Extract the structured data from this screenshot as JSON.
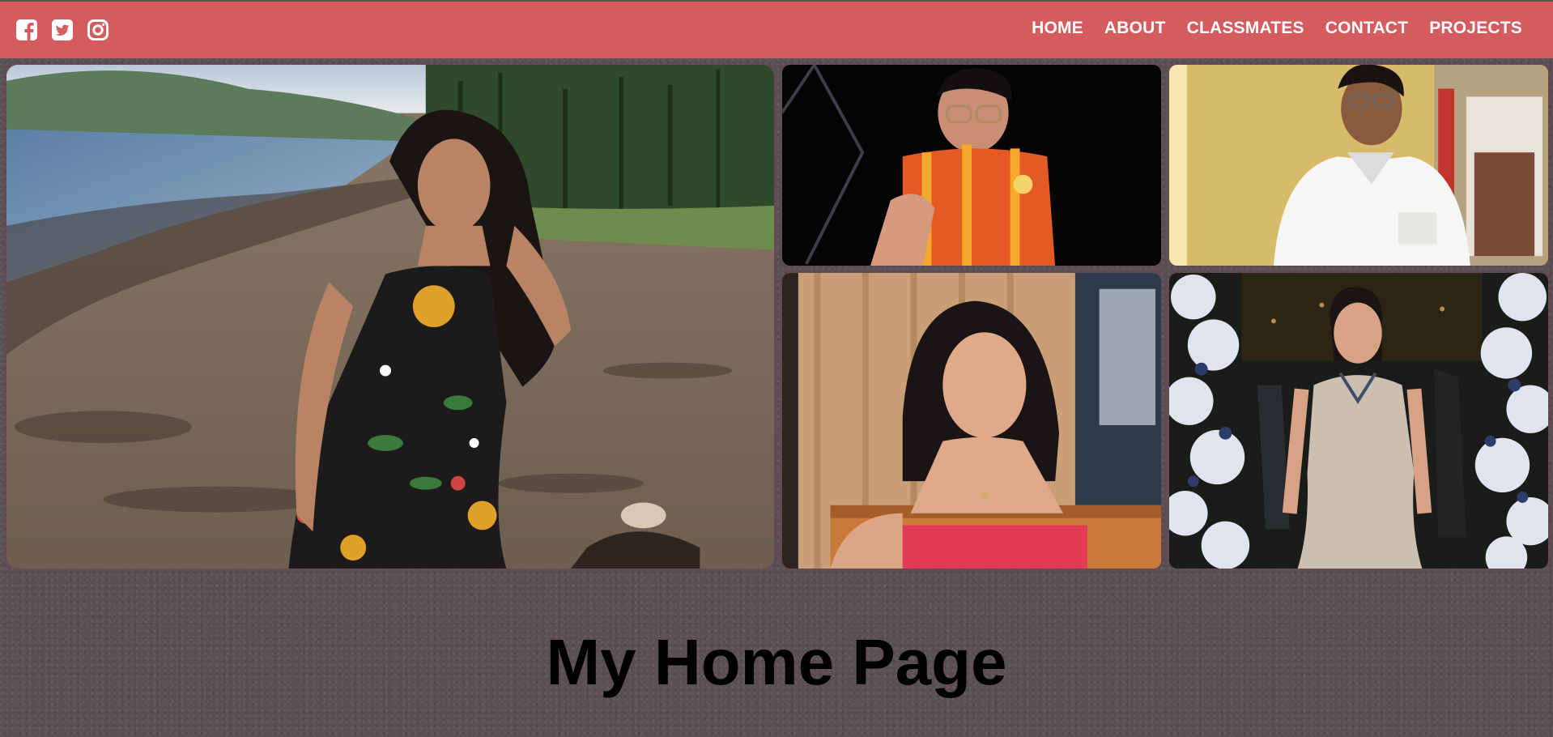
{
  "nav": {
    "social": [
      {
        "icon": "facebook-square-icon"
      },
      {
        "icon": "twitter-square-icon"
      },
      {
        "icon": "instagram-icon"
      }
    ],
    "links": [
      "HOME",
      "ABOUT",
      "CLASSMATES",
      "CONTACT",
      "PROJECTS"
    ]
  },
  "gallery": {
    "photos": [
      {
        "name": "beach-portrait-photo"
      },
      {
        "name": "selfie-jersey-photo"
      },
      {
        "name": "white-shirt-portrait-photo"
      },
      {
        "name": "restaurant-portrait-photo"
      },
      {
        "name": "gown-portrait-photo"
      }
    ]
  },
  "page": {
    "title": "My Home Page"
  },
  "colors": {
    "navbar": "#d55c5e",
    "background": "#5a4f54",
    "nav_text": "#ffffff"
  }
}
